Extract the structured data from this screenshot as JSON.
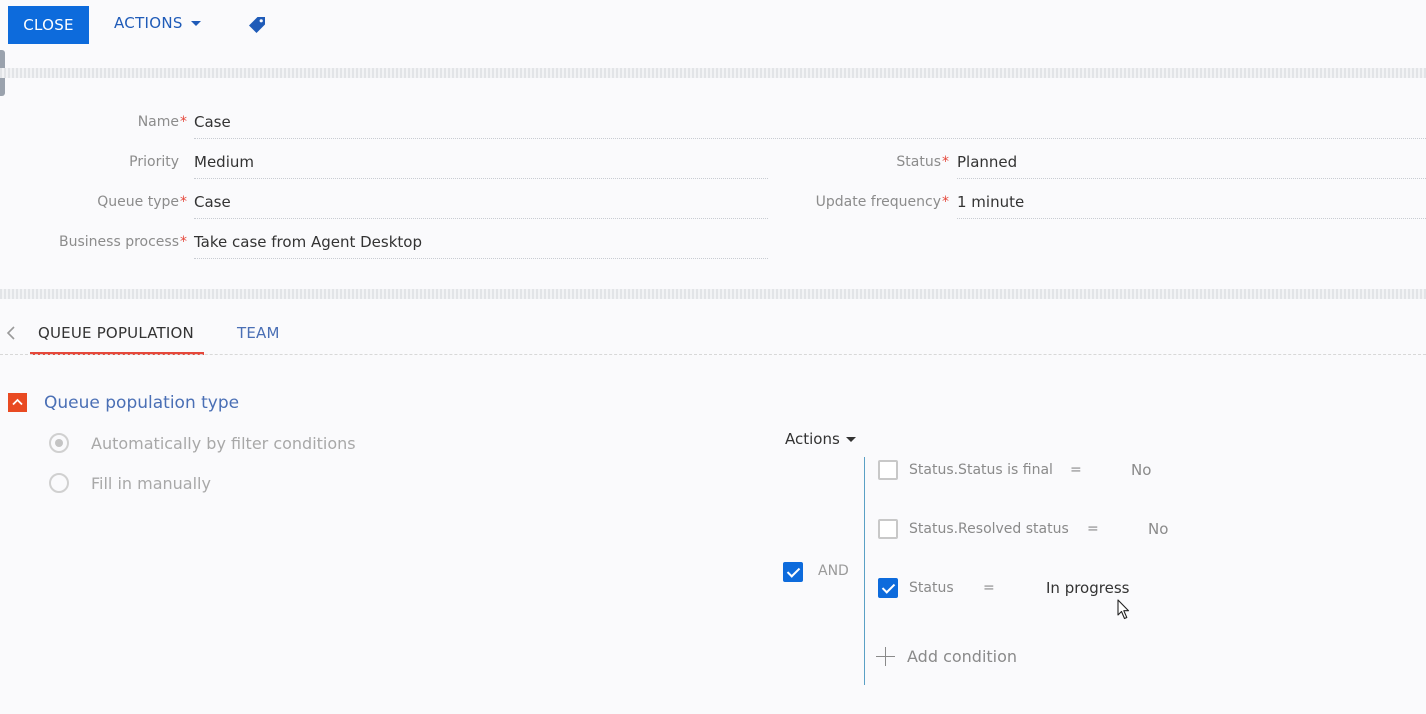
{
  "toolbar": {
    "close_label": "CLOSE",
    "actions_label": "ACTIONS",
    "tag_icon": "tag-icon"
  },
  "form": {
    "name": {
      "label": "Name",
      "required": "*",
      "value": "Case"
    },
    "priority": {
      "label": "Priority",
      "value": "Medium"
    },
    "queue_type": {
      "label": "Queue type",
      "required": "*",
      "value": "Case"
    },
    "business_process": {
      "label": "Business process",
      "required": "*",
      "value": "Take case from Agent Desktop"
    },
    "status": {
      "label": "Status",
      "required": "*",
      "value": "Planned"
    },
    "update_frequency": {
      "label": "Update frequency",
      "required": "*",
      "value": "1 minute"
    }
  },
  "tabs": [
    {
      "label": "QUEUE POPULATION",
      "active": true
    },
    {
      "label": "TEAM",
      "active": false
    }
  ],
  "group": {
    "title": "Queue population type",
    "options": [
      {
        "label": "Automatically by filter conditions",
        "selected": true
      },
      {
        "label": "Fill in manually",
        "selected": false
      }
    ]
  },
  "filter": {
    "actions_label": "Actions",
    "group_operator": "AND",
    "group_checked": true,
    "conditions": [
      {
        "column": "Status.Status is final",
        "operator": "=",
        "value": "No",
        "checked": false
      },
      {
        "column": "Status.Resolved status",
        "operator": "=",
        "value": "No",
        "checked": false
      },
      {
        "column": "Status",
        "operator": "=",
        "value": "In progress",
        "checked": true
      }
    ],
    "add_condition_label": "Add condition"
  },
  "colors": {
    "primary": "#0d6bdc",
    "accent": "#e5483b",
    "link": "#4a6fb5"
  }
}
